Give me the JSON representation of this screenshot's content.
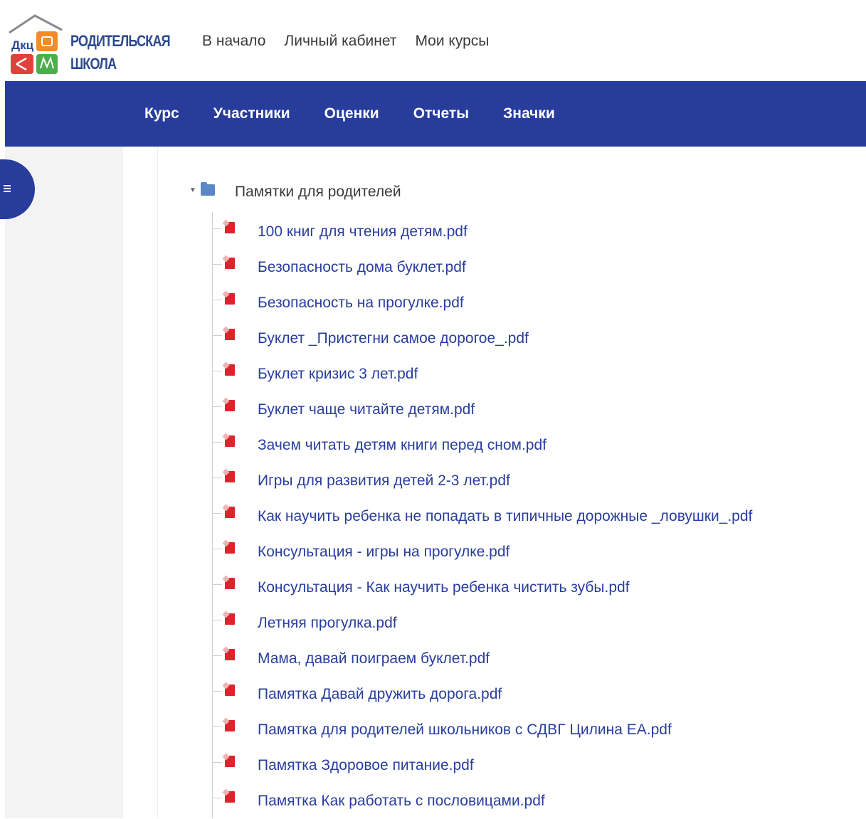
{
  "logo": {
    "line1": "РОДИТЕЛЬСКАЯ",
    "line2": "ШКОЛА",
    "badge": "Дкц"
  },
  "top_nav": [
    "В начало",
    "Личный кабинет",
    "Мои курсы"
  ],
  "course_tabs": [
    "Курс",
    "Участники",
    "Оценки",
    "Отчеты",
    "Значки"
  ],
  "active_tab": "Курс",
  "colors": {
    "brand_blue": "#283c9c",
    "link": "#293e9e",
    "pdf_red": "#d9262c",
    "folder": "#5b87c9"
  },
  "folder": {
    "title": "Памятки для родителей",
    "files": [
      "100 книг для чтения детям.pdf",
      "Безопасность дома буклет.pdf",
      "Безопасность на прогулке.pdf",
      "Буклет _Пристегни самое дорогое_.pdf",
      "Буклет кризис 3 лет.pdf",
      "Буклет чаще читайте детям.pdf",
      "Зачем читать детям книги перед сном.pdf",
      "Игры для развития детей 2-3 лет.pdf",
      "Как научить ребенка не попадать в типичные дорожные _ловушки_.pdf",
      "Консультация - игры на прогулке.pdf",
      "Консультация - Как научить ребенка чистить зубы.pdf",
      "Летняя прогулка.pdf",
      "Мама, давай поиграем буклет.pdf",
      "Памятка Давай дружить дорога.pdf",
      "Памятка для родителей школьников с СДВГ Цилина ЕА.pdf",
      "Памятка Здоровое питание.pdf",
      "Памятка Как работать с пословицами.pdf"
    ]
  }
}
